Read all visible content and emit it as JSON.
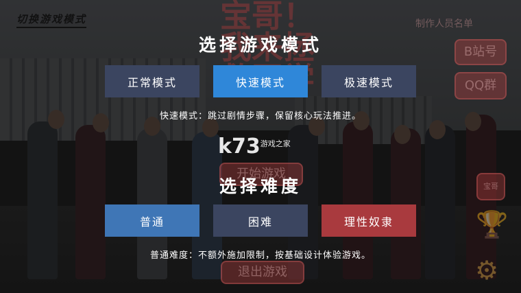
{
  "top_label": "切换游戏模式",
  "mode_section": {
    "title": "选择游戏模式",
    "options": [
      "正常模式",
      "快速模式",
      "极速模式"
    ],
    "selected": "快速模式",
    "description": "快速模式：跳过剧情步骤，保留核心玩法推进。"
  },
  "difficulty_section": {
    "title": "选择难度",
    "options": [
      "普通",
      "困难",
      "理性奴隶"
    ],
    "selected": "普通",
    "description": "普通难度：不额外施加限制，按基础设计体验游戏。"
  },
  "background": {
    "game_title": "宝哥！我来拯救同学",
    "right_text": "制作人员名单",
    "bilibili_button": "B站号",
    "qq_button": "QQ群",
    "start_button": "开始游戏",
    "exit_button": "退出游戏",
    "side_button": "宝哥"
  },
  "watermark": {
    "main": "k73",
    "sub": "游戏之家"
  },
  "colors": {
    "selected_mode": "#2f87d9",
    "unselected": "#3b4560",
    "normal_difficulty": "#3f76b6",
    "rational_difficulty": "#a93a3e"
  }
}
